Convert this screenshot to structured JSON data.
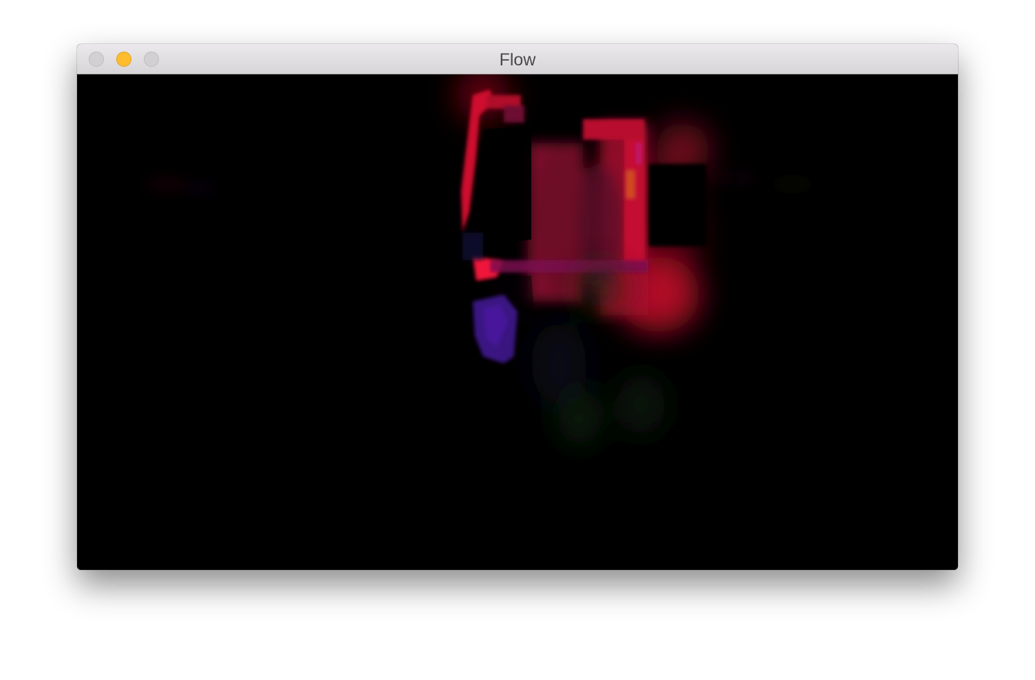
{
  "window": {
    "title": "Flow",
    "controls": {
      "close": "close-button",
      "minimize": "minimize-button",
      "zoom": "zoom-button"
    }
  },
  "colors": {
    "minimize": "#febc2e",
    "inactive_control": "#d2d0d2",
    "canvas_background": "#000000",
    "flow_red": "#e0103a",
    "flow_purple": "#3a1280",
    "flow_green": "#0c2a0c"
  }
}
